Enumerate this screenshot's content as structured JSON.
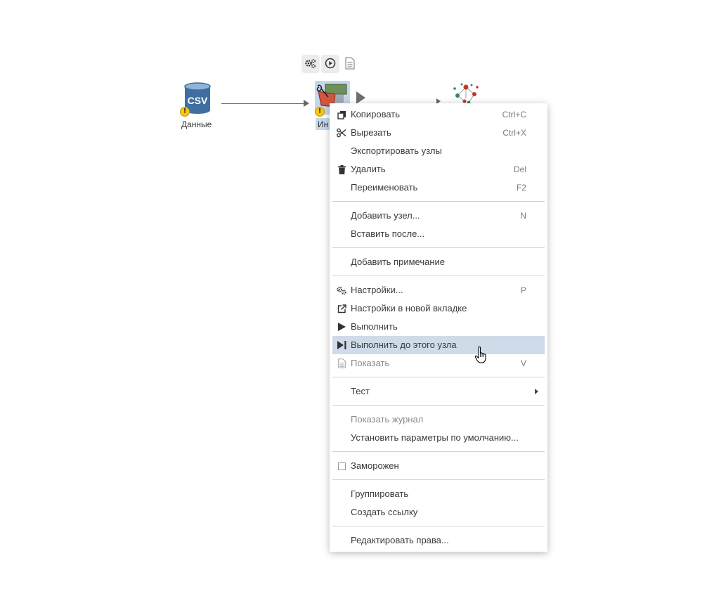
{
  "workflow": {
    "node_csv": {
      "icon_text": "CSV",
      "label": "Данные",
      "icon": "csv-database-icon",
      "color": "#3e6fa0"
    },
    "node_selected": {
      "label_partial": "Ин",
      "icon": "data-transform-node-icon"
    },
    "node_right": {
      "icon": "network-graph-node-icon"
    },
    "toolbar": {
      "settings_icon": "gears-icon",
      "execute_icon": "play-circle-icon",
      "view_icon": "document-icon"
    }
  },
  "context_menu": {
    "hover_color": "#cfdbe8",
    "groups": [
      [
        {
          "label": "Копировать",
          "shortcut": "Ctrl+C",
          "icon": "copy-icon"
        },
        {
          "label": "Вырезать",
          "shortcut": "Ctrl+X",
          "icon": "scissors-icon"
        },
        {
          "label": "Экспортировать узлы",
          "shortcut": ""
        },
        {
          "label": "Удалить",
          "shortcut": "Del",
          "icon": "trash-icon"
        },
        {
          "label": "Переименовать",
          "shortcut": "F2"
        }
      ],
      [
        {
          "label": "Добавить узел...",
          "shortcut": "N"
        },
        {
          "label": "Вставить после...",
          "shortcut": ""
        }
      ],
      [
        {
          "label": "Добавить примечание",
          "shortcut": ""
        }
      ],
      [
        {
          "label": "Настройки...",
          "shortcut": "P",
          "icon": "gears-icon"
        },
        {
          "label": "Настройки в новой вкладке",
          "shortcut": "",
          "icon": "external-link-icon"
        },
        {
          "label": "Выполнить",
          "shortcut": "",
          "icon": "play-icon"
        },
        {
          "label": "Выполнить до этого узла",
          "shortcut": "",
          "icon": "play-to-end-icon",
          "hovered": true
        },
        {
          "label": "Показать",
          "shortcut": "V",
          "icon": "document-icon",
          "disabled": true
        }
      ],
      [
        {
          "label": "Тест",
          "shortcut": "",
          "submenu": true
        }
      ],
      [
        {
          "label": "Показать журнал",
          "shortcut": "",
          "disabled": true
        },
        {
          "label": "Установить параметры по умолчанию...",
          "shortcut": ""
        }
      ],
      [
        {
          "label": "Заморожен",
          "shortcut": "",
          "checkbox": true,
          "checked": false
        }
      ],
      [
        {
          "label": "Группировать",
          "shortcut": ""
        },
        {
          "label": "Создать ссылку",
          "shortcut": ""
        }
      ],
      [
        {
          "label": "Редактировать права...",
          "shortcut": ""
        }
      ]
    ]
  }
}
